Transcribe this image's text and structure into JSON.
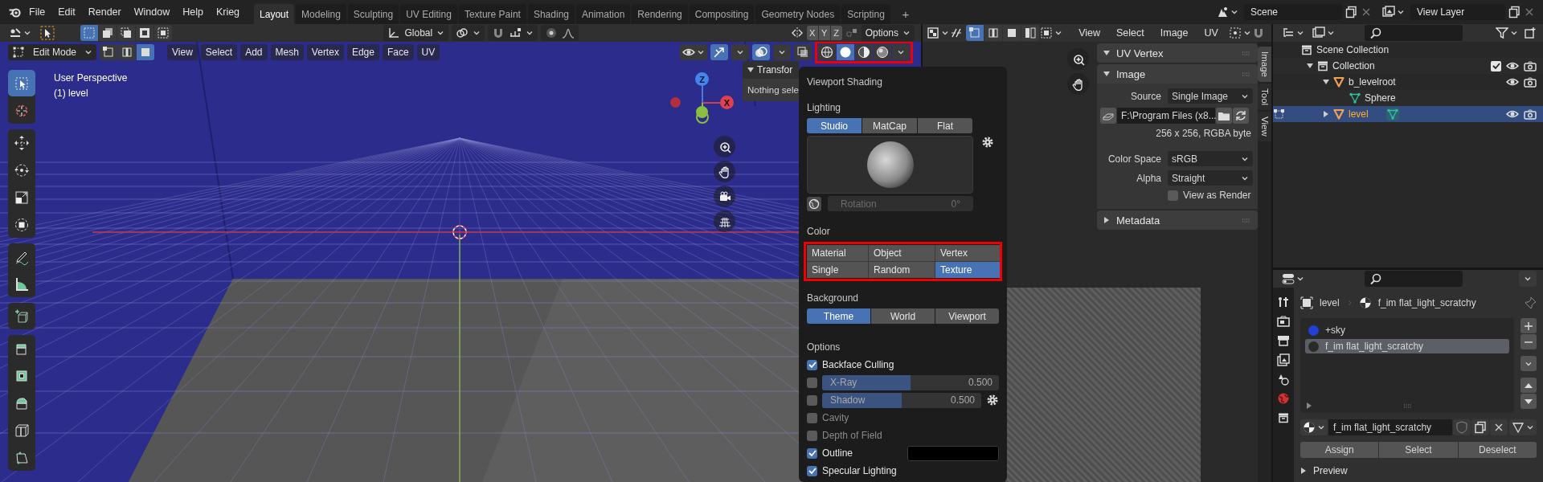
{
  "top_bar": {
    "menus": [
      "File",
      "Edit",
      "Render",
      "Window",
      "Help",
      "Krieg"
    ],
    "workspaces": [
      {
        "label": "Layout",
        "selected": true
      },
      {
        "label": "Modeling",
        "selected": false
      },
      {
        "label": "Sculpting",
        "selected": false
      },
      {
        "label": "UV Editing",
        "selected": false
      },
      {
        "label": "Texture Paint",
        "selected": false
      },
      {
        "label": "Shading",
        "selected": false
      },
      {
        "label": "Animation",
        "selected": false
      },
      {
        "label": "Rendering",
        "selected": false
      },
      {
        "label": "Compositing",
        "selected": false
      },
      {
        "label": "Geometry Nodes",
        "selected": false
      },
      {
        "label": "Scripting",
        "selected": false
      }
    ],
    "add_tab": "+",
    "scene": "Scene",
    "view_layer": "View Layer"
  },
  "viewport": {
    "tool_header": {
      "select_modes": [
        {
          "selected": true
        },
        {
          "selected": false
        },
        {
          "selected": false
        },
        {
          "selected": false
        },
        {
          "selected": false
        }
      ],
      "orientation": "Global",
      "axes": [
        "X",
        "Y",
        "Z"
      ],
      "options": "Options"
    },
    "header": {
      "mode": "Edit Mode",
      "select_modes": [
        {
          "selected": false
        },
        {
          "selected": false
        },
        {
          "selected": true
        }
      ],
      "menus": [
        "View",
        "Select",
        "Add",
        "Mesh",
        "Vertex",
        "Edge",
        "Face",
        "UV"
      ],
      "shading_modes": [
        {
          "selected": false
        },
        {
          "selected": true
        },
        {
          "selected": false
        },
        {
          "selected": false
        }
      ]
    },
    "overlay_text": [
      "User Perspective",
      "(1) level"
    ],
    "tools": [
      {
        "selected": true
      },
      {
        "selected": false
      },
      {
        "selected": false
      },
      {
        "selected": false
      },
      {
        "selected": false
      },
      {
        "selected": false
      },
      {
        "selected": false
      },
      {
        "selected": false
      },
      {
        "selected": false
      },
      {
        "selected": false
      },
      {
        "selected": false
      },
      {
        "selected": false
      },
      {
        "selected": false
      },
      {
        "selected": false
      }
    ],
    "gizmo_axes": [
      "Z",
      "X"
    ],
    "sidebar_panel": {
      "title": "Transfor",
      "expanded": true,
      "text": "Nothing sele"
    }
  },
  "shading_popover": {
    "title": "Viewport Shading",
    "lighting": {
      "label": "Lighting",
      "options": [
        {
          "label": "Studio",
          "selected": true
        },
        {
          "label": "MatCap",
          "selected": false
        },
        {
          "label": "Flat",
          "selected": false
        }
      ],
      "rotation_label": "Rotation",
      "rotation_value": "0°"
    },
    "color": {
      "label": "Color",
      "options": [
        {
          "label": "Material",
          "selected": false
        },
        {
          "label": "Object",
          "selected": false
        },
        {
          "label": "Vertex",
          "selected": false
        },
        {
          "label": "Single",
          "selected": false
        },
        {
          "label": "Random",
          "selected": false
        },
        {
          "label": "Texture",
          "selected": true
        }
      ]
    },
    "background": {
      "label": "Background",
      "options": [
        {
          "label": "Theme",
          "selected": true
        },
        {
          "label": "World",
          "selected": false
        },
        {
          "label": "Viewport",
          "selected": false
        }
      ]
    },
    "options": {
      "label": "Options",
      "items": [
        {
          "kind": "check",
          "label": "Backface Culling",
          "checked": true
        },
        {
          "kind": "slider",
          "label": "X-Ray",
          "checked": false,
          "level": 0.5,
          "value": "0.500",
          "settings": false
        },
        {
          "kind": "slider",
          "label": "Shadow",
          "checked": false,
          "level": 0.5,
          "value": "0.500",
          "settings": true
        },
        {
          "kind": "check",
          "label": "Cavity",
          "checked": false
        },
        {
          "kind": "check",
          "label": "Depth of Field",
          "checked": false
        },
        {
          "kind": "color",
          "label": "Outline",
          "checked": true,
          "color": "#000000"
        },
        {
          "kind": "check",
          "label": "Specular Lighting",
          "checked": true
        }
      ]
    }
  },
  "image_editor": {
    "header": {
      "select_modes": [
        {
          "selected": true
        },
        {
          "selected": false
        },
        {
          "selected": false
        },
        {
          "selected": false
        }
      ],
      "menus": [
        "View",
        "Select",
        "Image",
        "UV"
      ]
    },
    "panels": [
      {
        "kind": "empty",
        "title": "UV Vertex",
        "expanded": true
      },
      {
        "kind": "image",
        "title": "Image",
        "expanded": true,
        "source_label": "Source",
        "source": "Single Image",
        "filepath": "F:\\Program Files (x8...",
        "info": "256 x 256,  RGBA byte",
        "color_space_label": "Color Space",
        "color_space": "sRGB",
        "alpha_label": "Alpha",
        "alpha": "Straight",
        "view_as_render": {
          "label": "View as Render",
          "checked": false
        }
      },
      {
        "title": "Metadata",
        "expanded": false
      }
    ],
    "tabs": [
      {
        "label": "Image",
        "selected": true
      },
      {
        "label": "Tool",
        "selected": false
      },
      {
        "label": "View",
        "selected": false
      }
    ]
  },
  "outliner": {
    "tree": [
      {
        "kind": "scene",
        "label": "Scene Collection",
        "children": [
          {
            "kind": "collection",
            "label": "Collection",
            "expanded": true,
            "checked": true,
            "selected": false,
            "children": [
              {
                "kind": "object",
                "label": "b_levelroot",
                "expanded": true,
                "selected": false,
                "in_edit_mode": false,
                "children": [
                  {
                    "kind": "mesh",
                    "label": "Sphere",
                    "selected": false
                  }
                ]
              },
              {
                "kind": "object",
                "label": "level",
                "expanded": false,
                "selected": true,
                "in_edit_mode": true
              }
            ]
          }
        ]
      }
    ]
  },
  "properties": {
    "breadcrumb": [
      "level",
      "f_im flat_light_scratchy"
    ],
    "material_slots": [
      {
        "label": "+sky",
        "color": "#2040d8",
        "selected": false
      },
      {
        "label": "f_im flat_light_scratchy",
        "color": "#2a2a2a",
        "selected": true
      }
    ],
    "material_name": "f_im flat_light_scratchy",
    "buttons": [
      "Assign",
      "Select",
      "Deselect"
    ],
    "preview": {
      "title": "Preview",
      "expanded": false
    }
  }
}
